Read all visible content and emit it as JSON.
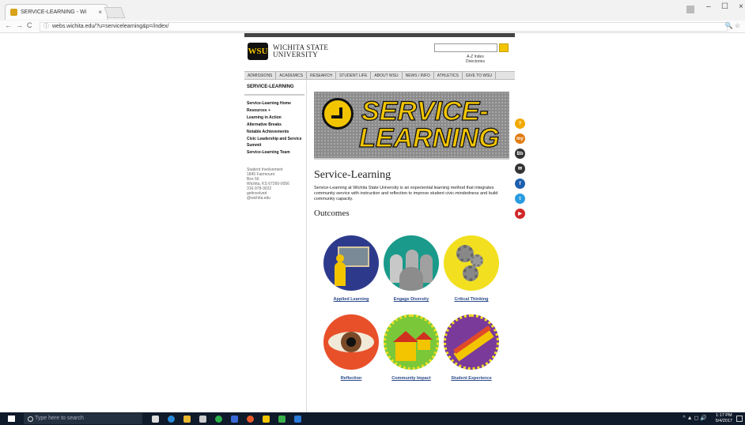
{
  "browser": {
    "tab_title": "SERVICE-LEARNING - Wi",
    "tab_close": "×",
    "url": "webs.wichita.edu/?u=servicelearning&p=/index/",
    "back": "←",
    "forward": "→",
    "reload": "C",
    "info": "ⓘ",
    "toolbar_right": "🔍 ☆",
    "minimize": "–",
    "maximize": "☐",
    "close": "×"
  },
  "site": {
    "logo_mark": "WSU",
    "logo_line1": "WICHITA STATE",
    "logo_line2": "UNIVERSITY",
    "util_links": "A-Z Index\nDirectories",
    "main_nav": [
      "ADMISSIONS",
      "ACADEMICS",
      "RESEARCH",
      "STUDENT LIFE",
      "ABOUT WSU",
      "NEWS / INFO",
      "ATHLETICS",
      "GIVE TO WSU"
    ],
    "section_title": "SERVICE-LEARNING",
    "left_nav": [
      "Service-Learning Home",
      "Resources +",
      "Learning in Action",
      "Alternative Breaks",
      "Notable Achievements",
      "Civic Leadership and Service Summit",
      "Service-Learning Team"
    ],
    "contact": [
      "Student Involvement",
      "1845 Fairmount",
      "Box 56",
      "Wichita, KS 67260-0056",
      "316-978-3022",
      "getinvolved",
      "@wichita.edu"
    ],
    "hero_line1": "SERVICE-",
    "hero_line2": "LEARNING",
    "page_title": "Service-Learning",
    "intro": "Service-Learning at Wichita State University is an experiential learning method that integrates community service with instruction and reflection to improve student civic-mindedness and build community capacity.",
    "outcomes_heading": "Outcomes",
    "tiles": [
      {
        "label": "Applied Learning"
      },
      {
        "label": "Engage Diversity"
      },
      {
        "label": "Critical Thinking"
      },
      {
        "label": "Reflection"
      },
      {
        "label": "Community Impact"
      },
      {
        "label": "Student Experience"
      }
    ],
    "social": [
      {
        "name": "help-icon",
        "glyph": "?",
        "color": "#f2a900"
      },
      {
        "name": "mywsu-icon",
        "glyph": "my",
        "color": "#e07a10"
      },
      {
        "name": "blackboard-icon",
        "glyph": "Bb",
        "color": "#333333"
      },
      {
        "name": "email-icon",
        "glyph": "✉",
        "color": "#333333"
      },
      {
        "name": "facebook-icon",
        "glyph": "f",
        "color": "#1f5fb0"
      },
      {
        "name": "twitter-icon",
        "glyph": "t",
        "color": "#2a9be0"
      },
      {
        "name": "youtube-icon",
        "glyph": "▶",
        "color": "#d0282a"
      }
    ]
  },
  "taskbar": {
    "search_placeholder": "Type here to search",
    "time": "1:17 PM",
    "date": "5/4/2017",
    "tray": "^ ▲ ◻ 🔊"
  }
}
